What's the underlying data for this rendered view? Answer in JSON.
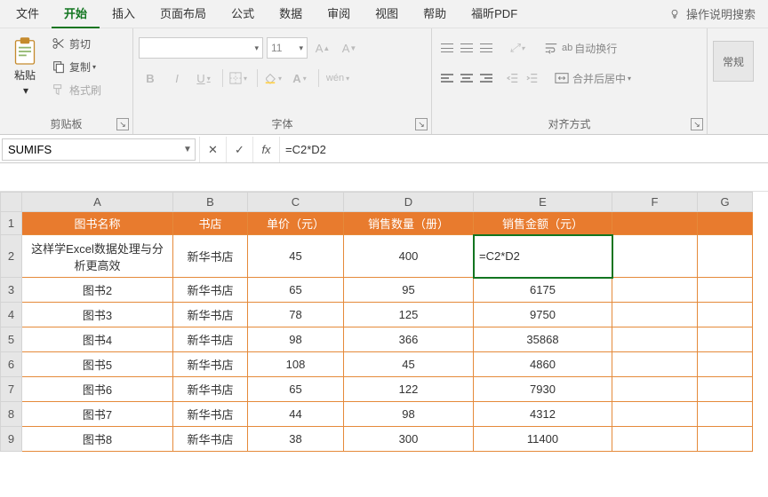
{
  "menu": {
    "items": [
      "文件",
      "开始",
      "插入",
      "页面布局",
      "公式",
      "数据",
      "审阅",
      "视图",
      "帮助",
      "福昕PDF"
    ],
    "active_index": 1,
    "tellme": "操作说明搜索"
  },
  "ribbon": {
    "clipboard": {
      "label": "剪贴板",
      "paste": "粘贴",
      "cut": "剪切",
      "copy": "复制",
      "format_painter": "格式刷"
    },
    "font": {
      "label": "字体",
      "size_value": "11",
      "buttons": {
        "bold": "B",
        "italic": "I",
        "underline": "U",
        "ruby": "wén"
      }
    },
    "alignment": {
      "label": "对齐方式",
      "wrap": "自动换行",
      "merge": "合并后居中",
      "ab_rotate": "ab"
    },
    "styles": {
      "label": "",
      "general": "常规"
    }
  },
  "namebox": "SUMIFS",
  "formula": "=C2*D2",
  "columns": [
    "A",
    "B",
    "C",
    "D",
    "E",
    "F",
    "G"
  ],
  "headers": [
    "图书名称",
    "书店",
    "单价（元）",
    "销售数量（册）",
    "销售金额（元）"
  ],
  "rows": [
    {
      "n": "1"
    },
    {
      "n": "2",
      "a": "这样学Excel数据处理与分析更高效",
      "b": "新华书店",
      "c": "45",
      "d": "400",
      "e": "=C2*D2"
    },
    {
      "n": "3",
      "a": "图书2",
      "b": "新华书店",
      "c": "65",
      "d": "95",
      "e": "6175"
    },
    {
      "n": "4",
      "a": "图书3",
      "b": "新华书店",
      "c": "78",
      "d": "125",
      "e": "9750"
    },
    {
      "n": "5",
      "a": "图书4",
      "b": "新华书店",
      "c": "98",
      "d": "366",
      "e": "35868"
    },
    {
      "n": "6",
      "a": "图书5",
      "b": "新华书店",
      "c": "108",
      "d": "45",
      "e": "4860"
    },
    {
      "n": "7",
      "a": "图书6",
      "b": "新华书店",
      "c": "65",
      "d": "122",
      "e": "7930"
    },
    {
      "n": "8",
      "a": "图书7",
      "b": "新华书店",
      "c": "44",
      "d": "98",
      "e": "4312"
    },
    {
      "n": "9",
      "a": "图书8",
      "b": "新华书店",
      "c": "38",
      "d": "300",
      "e": "11400"
    }
  ]
}
